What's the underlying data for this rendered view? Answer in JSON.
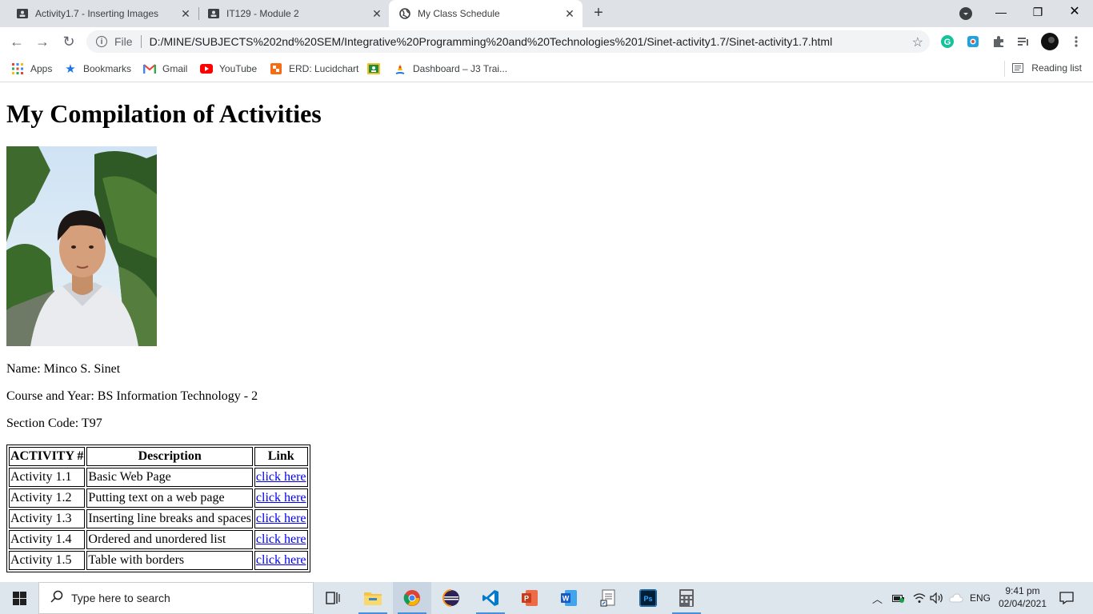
{
  "browser": {
    "tabs": [
      {
        "title": "Activity1.7 - Inserting Images",
        "icon": "classroom-icon"
      },
      {
        "title": "IT129 - Module 2",
        "icon": "classroom-icon"
      },
      {
        "title": "My Class Schedule",
        "icon": "globe-icon",
        "active": true
      }
    ],
    "address": {
      "scheme": "File",
      "url": "D:/MINE/SUBJECTS%202nd%20SEM/Integrative%20Programming%20and%20Technologies%201/Sinet-activity1.7/Sinet-activity1.7.html"
    },
    "bookmarks": [
      {
        "label": "Apps",
        "icon": "apps-grid-icon"
      },
      {
        "label": "Bookmarks",
        "icon": "star-icon"
      },
      {
        "label": "Gmail",
        "icon": "gmail-icon"
      },
      {
        "label": "YouTube",
        "icon": "youtube-icon"
      },
      {
        "label": "ERD: Lucidchart",
        "icon": "lucidchart-icon"
      },
      {
        "label": "",
        "icon": "classroom-icon"
      },
      {
        "label": "Dashboard – J3 Trai...",
        "icon": "dashboard-icon"
      }
    ],
    "reading_list": "Reading list"
  },
  "page": {
    "heading": "My Compilation of Activities",
    "name": "Name: Minco S. Sinet",
    "course": "Course and Year: BS Information Technology - 2",
    "section": "Section Code: T97",
    "table": {
      "headers": [
        "ACTIVITY #",
        "Description",
        "Link"
      ],
      "rows": [
        {
          "activity": "Activity 1.1",
          "description": "Basic Web Page",
          "link": "click here"
        },
        {
          "activity": "Activity 1.2",
          "description": "Putting text on a web page",
          "link": "click here"
        },
        {
          "activity": "Activity 1.3",
          "description": "Inserting line breaks and spaces",
          "link": "click here"
        },
        {
          "activity": "Activity 1.4",
          "description": "Ordered and unordered list",
          "link": "click here"
        },
        {
          "activity": "Activity 1.5",
          "description": "Table with borders",
          "link": "click here"
        }
      ]
    }
  },
  "taskbar": {
    "search_placeholder": "Type here to search",
    "language": "ENG",
    "time": "9:41 pm",
    "date": "02/04/2021"
  }
}
